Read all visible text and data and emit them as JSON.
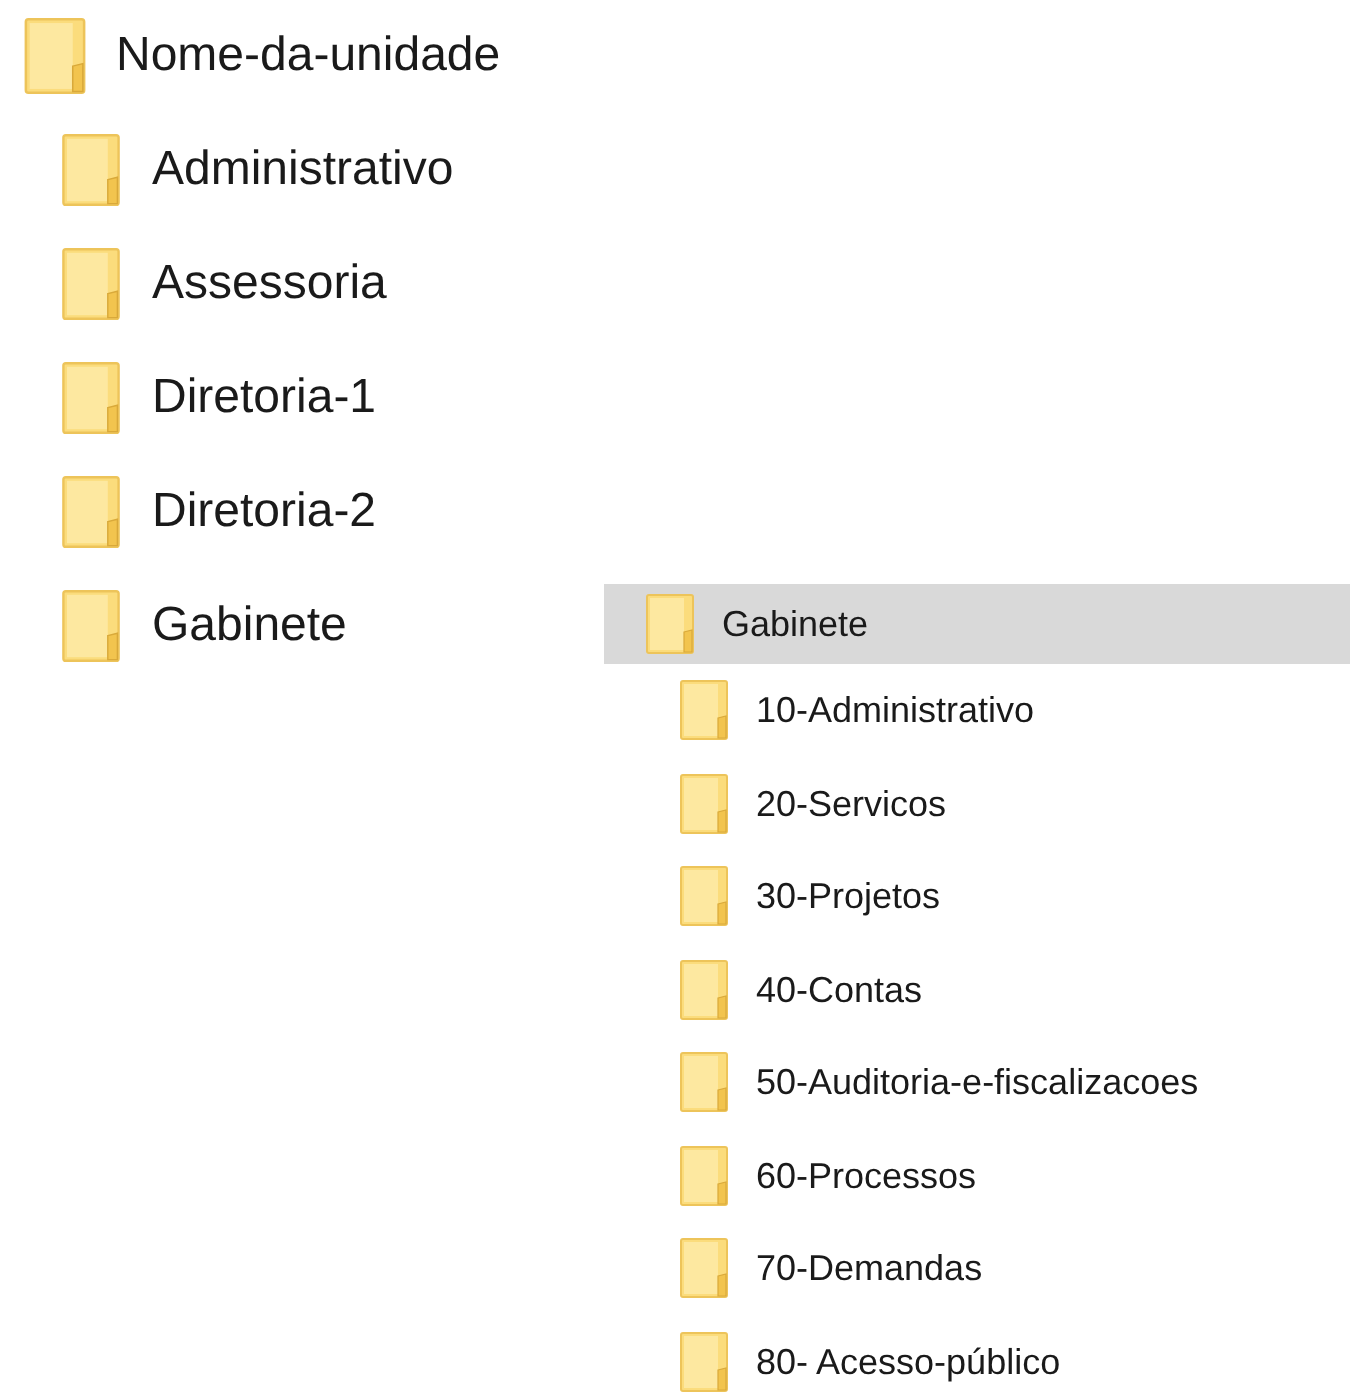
{
  "tree": {
    "label": "Nome-da-unidade",
    "children": [
      {
        "label": "Administrativo"
      },
      {
        "label": "Assessoria"
      },
      {
        "label": "Diretoria-1"
      },
      {
        "label": "Diretoria-2"
      },
      {
        "label": "Gabinete"
      }
    ]
  },
  "panel": {
    "label": "Gabinete",
    "selected": true,
    "children": [
      {
        "label": "10-Administrativo",
        "selected": false
      },
      {
        "label": "20-Servicos",
        "selected": false
      },
      {
        "label": "30-Projetos",
        "selected": false
      },
      {
        "label": "40-Contas",
        "selected": false
      },
      {
        "label": "50-Auditoria-e-fiscalizacoes",
        "selected": false
      },
      {
        "label": "60-Processos",
        "selected": false
      },
      {
        "label": "70-Demandas",
        "selected": false
      },
      {
        "label": "80- Acesso-público",
        "selected": false
      }
    ]
  }
}
